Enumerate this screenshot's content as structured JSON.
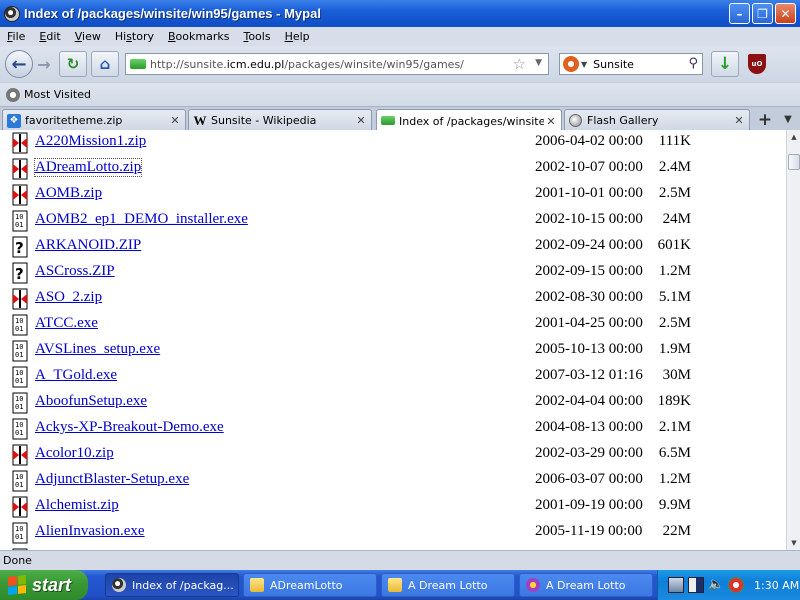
{
  "window": {
    "title": "Index of /packages/winsite/win95/games - Mypal"
  },
  "menu": [
    {
      "pre": "",
      "key": "F",
      "post": "ile"
    },
    {
      "pre": "",
      "key": "E",
      "post": "dit"
    },
    {
      "pre": "",
      "key": "V",
      "post": "iew"
    },
    {
      "pre": "Hi",
      "key": "s",
      "post": "tory"
    },
    {
      "pre": "",
      "key": "B",
      "post": "ookmarks"
    },
    {
      "pre": "",
      "key": "T",
      "post": "ools"
    },
    {
      "pre": "",
      "key": "H",
      "post": "elp"
    }
  ],
  "nav": {
    "url_pre": "http://sunsite.",
    "url_domain": "icm.edu.pl",
    "url_post": "/packages/winsite/win95/games/",
    "search_engine": "Sunsite"
  },
  "bookmarks": {
    "most_visited": "Most Visited"
  },
  "tabs": [
    {
      "label": "favoritetheme.zip",
      "icon": "dropbox-icon",
      "active": false
    },
    {
      "label": "Sunsite - Wikipedia",
      "icon": "wikipedia-icon",
      "active": false
    },
    {
      "label": "Index of /packages/winsite/...",
      "icon": "sunsite-icon",
      "active": true
    },
    {
      "label": "Flash Gallery",
      "icon": "globe-icon",
      "active": false
    }
  ],
  "files": [
    {
      "name": "A220Mission1.zip",
      "date": "2006-04-02 00:00",
      "size": "111K",
      "type": "zip"
    },
    {
      "name": "ADreamLotto.zip",
      "date": "2002-10-07 00:00",
      "size": "2.4M",
      "type": "zip"
    },
    {
      "name": "AOMB.zip",
      "date": "2001-10-01 00:00",
      "size": "2.5M",
      "type": "zip"
    },
    {
      "name": "AOMB2_ep1_DEMO_installer.exe",
      "date": "2002-10-15 00:00",
      "size": "24M",
      "type": "exe"
    },
    {
      "name": "ARKANOID.ZIP",
      "date": "2002-09-24 00:00",
      "size": "601K",
      "type": "unknown"
    },
    {
      "name": "ASCross.ZIP",
      "date": "2002-09-15 00:00",
      "size": "1.2M",
      "type": "unknown"
    },
    {
      "name": "ASO_2.zip",
      "date": "2002-08-30 00:00",
      "size": "5.1M",
      "type": "zip"
    },
    {
      "name": "ATCC.exe",
      "date": "2001-04-25 00:00",
      "size": "2.5M",
      "type": "exe"
    },
    {
      "name": "AVSLines_setup.exe",
      "date": "2005-10-13 00:00",
      "size": "1.9M",
      "type": "exe"
    },
    {
      "name": "A_TGold.exe",
      "date": "2007-03-12 01:16",
      "size": "30M",
      "type": "exe"
    },
    {
      "name": "AboofunSetup.exe",
      "date": "2002-04-04 00:00",
      "size": "189K",
      "type": "exe"
    },
    {
      "name": "Ackys-XP-Breakout-Demo.exe",
      "date": "2004-08-13 00:00",
      "size": "2.1M",
      "type": "exe"
    },
    {
      "name": "Acolor10.zip",
      "date": "2002-03-29 00:00",
      "size": "6.5M",
      "type": "zip"
    },
    {
      "name": "AdjunctBlaster-Setup.exe",
      "date": "2006-03-07 00:00",
      "size": "1.2M",
      "type": "exe"
    },
    {
      "name": "Alchemist.zip",
      "date": "2001-09-19 00:00",
      "size": "9.9M",
      "type": "zip"
    },
    {
      "name": "AlienInvasion.exe",
      "date": "2005-11-19 00:00",
      "size": "22M",
      "type": "exe"
    }
  ],
  "status": {
    "text": "Done"
  },
  "taskbar": {
    "start": "start",
    "tasks": [
      {
        "label": "Index of /packag...",
        "icon": "mypal-icon",
        "active": true
      },
      {
        "label": "ADreamLotto",
        "icon": "folder-icon",
        "active": false
      },
      {
        "label": "A Dream Lotto",
        "icon": "folder-icon",
        "active": false
      },
      {
        "label": "A Dream Lotto",
        "icon": "lotto-app-icon",
        "active": false
      }
    ],
    "clock": "1:30 AM"
  },
  "colors": {
    "link": "#0000cc",
    "titlebar": "#1a5ed8",
    "taskbar": "#2458d2",
    "start": "#3a9a35"
  }
}
